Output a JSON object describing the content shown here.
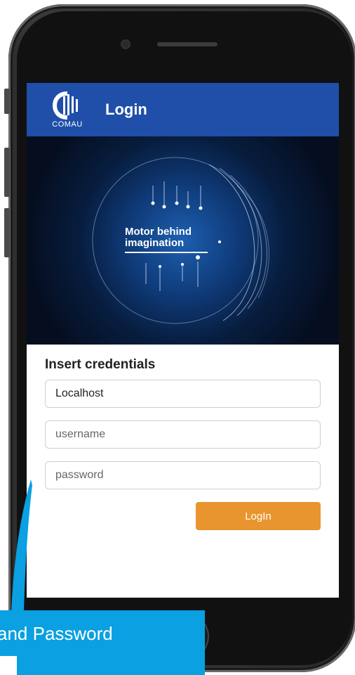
{
  "header": {
    "title": "Login",
    "logo_text": "COMAU"
  },
  "hero": {
    "line1": "Motor behind",
    "line2": "imagination"
  },
  "form": {
    "heading": "Insert credentials",
    "host_value": "Localhost",
    "username_placeholder": "username",
    "password_placeholder": "password",
    "login_label": "LogIn"
  },
  "callout": {
    "text": "and Password"
  },
  "colors": {
    "appbar": "#1f4fa8",
    "login_button": "#e8952f",
    "callout": "#0aa0e1"
  },
  "icons": {
    "logo": "comau-logo-icon"
  }
}
